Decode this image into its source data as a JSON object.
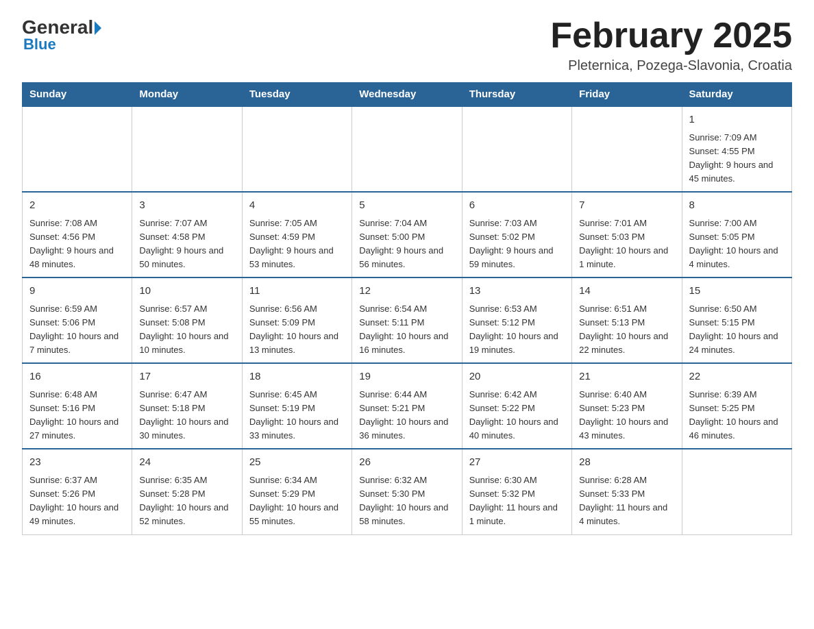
{
  "logo": {
    "general": "General",
    "blue": "Blue",
    "tagline": "Blue"
  },
  "header": {
    "title": "February 2025",
    "location": "Pleternica, Pozega-Slavonia, Croatia"
  },
  "columns": [
    "Sunday",
    "Monday",
    "Tuesday",
    "Wednesday",
    "Thursday",
    "Friday",
    "Saturday"
  ],
  "weeks": [
    [
      {
        "day": "",
        "info": ""
      },
      {
        "day": "",
        "info": ""
      },
      {
        "day": "",
        "info": ""
      },
      {
        "day": "",
        "info": ""
      },
      {
        "day": "",
        "info": ""
      },
      {
        "day": "",
        "info": ""
      },
      {
        "day": "1",
        "info": "Sunrise: 7:09 AM\nSunset: 4:55 PM\nDaylight: 9 hours and 45 minutes."
      }
    ],
    [
      {
        "day": "2",
        "info": "Sunrise: 7:08 AM\nSunset: 4:56 PM\nDaylight: 9 hours and 48 minutes."
      },
      {
        "day": "3",
        "info": "Sunrise: 7:07 AM\nSunset: 4:58 PM\nDaylight: 9 hours and 50 minutes."
      },
      {
        "day": "4",
        "info": "Sunrise: 7:05 AM\nSunset: 4:59 PM\nDaylight: 9 hours and 53 minutes."
      },
      {
        "day": "5",
        "info": "Sunrise: 7:04 AM\nSunset: 5:00 PM\nDaylight: 9 hours and 56 minutes."
      },
      {
        "day": "6",
        "info": "Sunrise: 7:03 AM\nSunset: 5:02 PM\nDaylight: 9 hours and 59 minutes."
      },
      {
        "day": "7",
        "info": "Sunrise: 7:01 AM\nSunset: 5:03 PM\nDaylight: 10 hours and 1 minute."
      },
      {
        "day": "8",
        "info": "Sunrise: 7:00 AM\nSunset: 5:05 PM\nDaylight: 10 hours and 4 minutes."
      }
    ],
    [
      {
        "day": "9",
        "info": "Sunrise: 6:59 AM\nSunset: 5:06 PM\nDaylight: 10 hours and 7 minutes."
      },
      {
        "day": "10",
        "info": "Sunrise: 6:57 AM\nSunset: 5:08 PM\nDaylight: 10 hours and 10 minutes."
      },
      {
        "day": "11",
        "info": "Sunrise: 6:56 AM\nSunset: 5:09 PM\nDaylight: 10 hours and 13 minutes."
      },
      {
        "day": "12",
        "info": "Sunrise: 6:54 AM\nSunset: 5:11 PM\nDaylight: 10 hours and 16 minutes."
      },
      {
        "day": "13",
        "info": "Sunrise: 6:53 AM\nSunset: 5:12 PM\nDaylight: 10 hours and 19 minutes."
      },
      {
        "day": "14",
        "info": "Sunrise: 6:51 AM\nSunset: 5:13 PM\nDaylight: 10 hours and 22 minutes."
      },
      {
        "day": "15",
        "info": "Sunrise: 6:50 AM\nSunset: 5:15 PM\nDaylight: 10 hours and 24 minutes."
      }
    ],
    [
      {
        "day": "16",
        "info": "Sunrise: 6:48 AM\nSunset: 5:16 PM\nDaylight: 10 hours and 27 minutes."
      },
      {
        "day": "17",
        "info": "Sunrise: 6:47 AM\nSunset: 5:18 PM\nDaylight: 10 hours and 30 minutes."
      },
      {
        "day": "18",
        "info": "Sunrise: 6:45 AM\nSunset: 5:19 PM\nDaylight: 10 hours and 33 minutes."
      },
      {
        "day": "19",
        "info": "Sunrise: 6:44 AM\nSunset: 5:21 PM\nDaylight: 10 hours and 36 minutes."
      },
      {
        "day": "20",
        "info": "Sunrise: 6:42 AM\nSunset: 5:22 PM\nDaylight: 10 hours and 40 minutes."
      },
      {
        "day": "21",
        "info": "Sunrise: 6:40 AM\nSunset: 5:23 PM\nDaylight: 10 hours and 43 minutes."
      },
      {
        "day": "22",
        "info": "Sunrise: 6:39 AM\nSunset: 5:25 PM\nDaylight: 10 hours and 46 minutes."
      }
    ],
    [
      {
        "day": "23",
        "info": "Sunrise: 6:37 AM\nSunset: 5:26 PM\nDaylight: 10 hours and 49 minutes."
      },
      {
        "day": "24",
        "info": "Sunrise: 6:35 AM\nSunset: 5:28 PM\nDaylight: 10 hours and 52 minutes."
      },
      {
        "day": "25",
        "info": "Sunrise: 6:34 AM\nSunset: 5:29 PM\nDaylight: 10 hours and 55 minutes."
      },
      {
        "day": "26",
        "info": "Sunrise: 6:32 AM\nSunset: 5:30 PM\nDaylight: 10 hours and 58 minutes."
      },
      {
        "day": "27",
        "info": "Sunrise: 6:30 AM\nSunset: 5:32 PM\nDaylight: 11 hours and 1 minute."
      },
      {
        "day": "28",
        "info": "Sunrise: 6:28 AM\nSunset: 5:33 PM\nDaylight: 11 hours and 4 minutes."
      },
      {
        "day": "",
        "info": ""
      }
    ]
  ]
}
